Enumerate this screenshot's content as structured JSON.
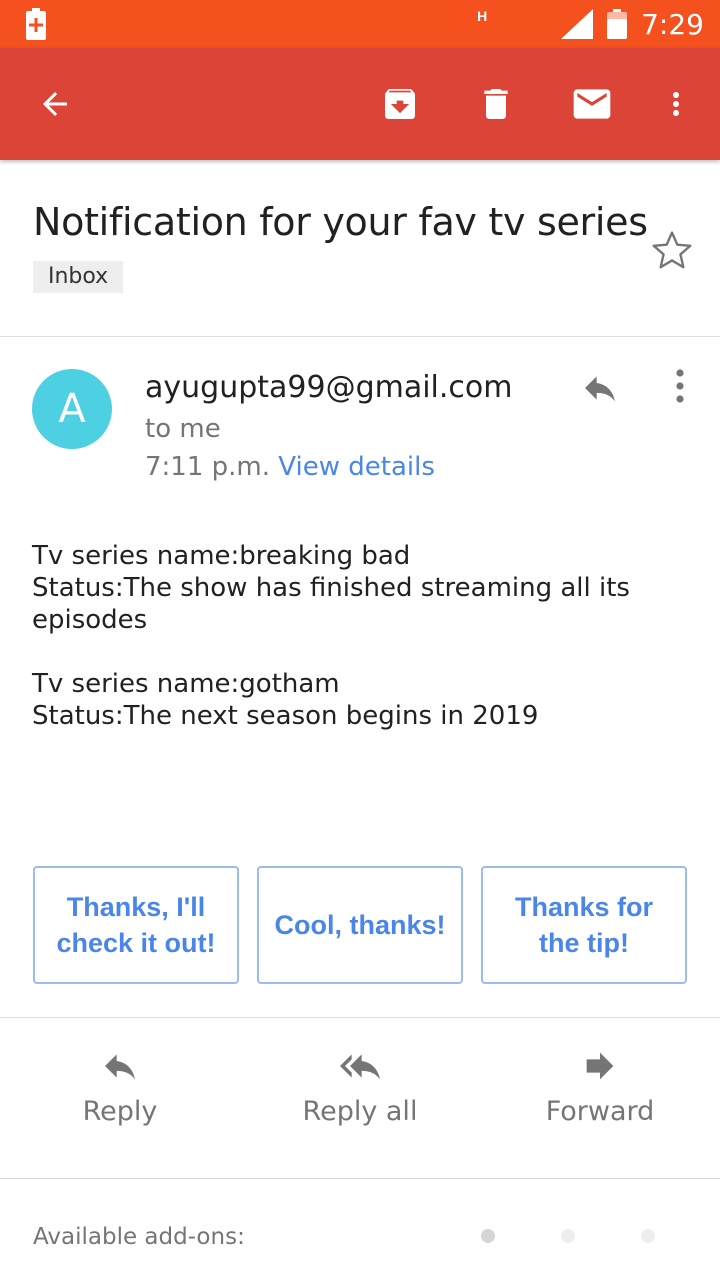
{
  "status_bar": {
    "network_type": "H",
    "time": "7:29"
  },
  "app_bar": {
    "color": "#DB4437",
    "icons": [
      "back-arrow-icon",
      "archive-icon",
      "delete-icon",
      "mark-unread-icon",
      "more-vert-icon"
    ]
  },
  "email": {
    "subject": "Notification for your fav tv series",
    "label": "Inbox",
    "sender_initial": "A",
    "sender": "ayugupta99@gmail.com",
    "recipient": "to me",
    "time": "7:11 p.m.",
    "view_details": "View details",
    "body": {
      "line1": "Tv series name:breaking bad",
      "line2": "Status:The show has finished streaming all its episodes",
      "line3": "Tv series name:gotham",
      "line4": "Status:The next season begins in 2019"
    }
  },
  "smart_replies": [
    "Thanks, I'll check it out!",
    "Cool, thanks!",
    "Thanks for the tip!"
  ],
  "actions": {
    "reply": "Reply",
    "reply_all": "Reply all",
    "forward": "Forward"
  },
  "addons": {
    "label": "Available add-ons:"
  }
}
